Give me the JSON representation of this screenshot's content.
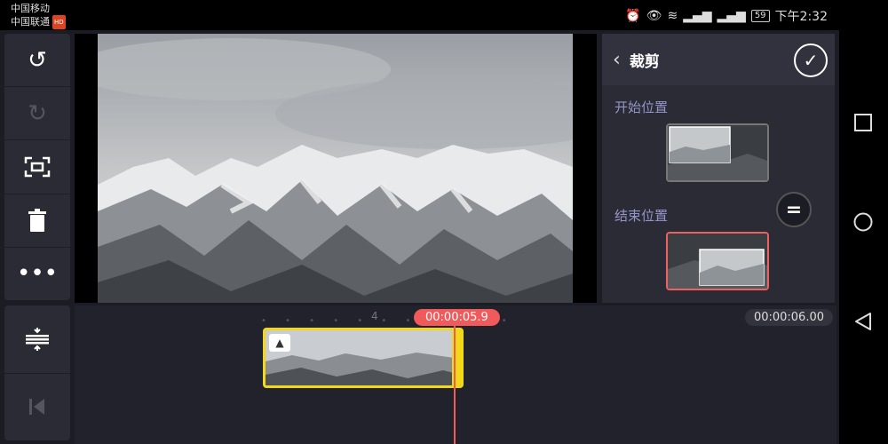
{
  "status_bar": {
    "carrier1": "中国移动",
    "carrier2": "中国联通",
    "hd_badge": "HD",
    "battery": "59",
    "time": "下午2:32"
  },
  "toolbar": {
    "undo_icon": "undo-icon",
    "redo_icon": "redo-icon",
    "crop_icon": "crop-icon",
    "delete_icon": "trash-icon",
    "more_icon": "more-icon",
    "split_icon": "split-icon",
    "skip_start_icon": "skip-start-icon"
  },
  "panel": {
    "title": "裁剪",
    "start_label": "开始位置",
    "end_label": "结束位置",
    "swap_symbol": "="
  },
  "timeline": {
    "ruler_number": "4",
    "current_time": "00:00:05.9",
    "total_time": "00:00:06.00"
  },
  "colors": {
    "accent": "#f05a5a",
    "clip_border": "#f1d91a",
    "label": "#9494c8"
  }
}
